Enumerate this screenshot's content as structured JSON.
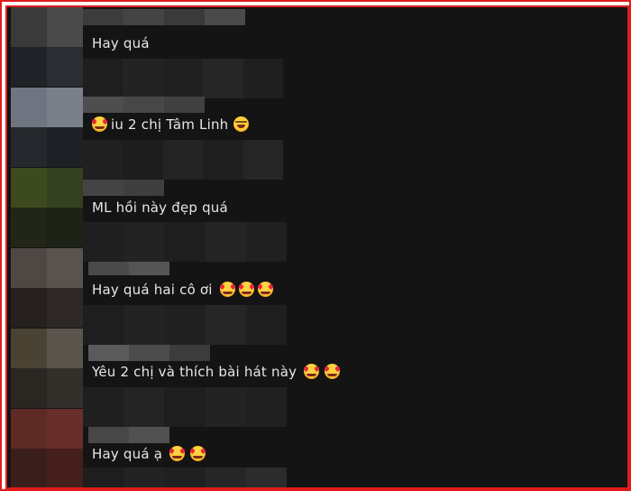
{
  "comments": [
    {
      "text": "Hay quá",
      "emojis": []
    },
    {
      "text": "iu 2 chị Tâm Linh",
      "lead_emoji": "smiling-face-with-hearts",
      "emojis": [
        "grinning-squinting-face"
      ]
    },
    {
      "text": "ML hồi này đẹp quá",
      "emojis": []
    },
    {
      "text": "Hay quá hai cô ơi",
      "emojis": [
        "smiling-face-with-hearts",
        "smiling-face-with-hearts",
        "smiling-face-with-hearts"
      ]
    },
    {
      "text": "Yêu 2 chị và thích bài hát này",
      "emojis": [
        "smiling-face-with-hearts",
        "smiling-face-with-hearts"
      ]
    },
    {
      "text": "Hay quá ạ",
      "emojis": [
        "smiling-face-with-hearts",
        "smiling-face-with-hearts"
      ]
    }
  ],
  "colors": {
    "frame_border": "#e01c1c",
    "background": "#141414",
    "text": "#e6e6e6"
  }
}
